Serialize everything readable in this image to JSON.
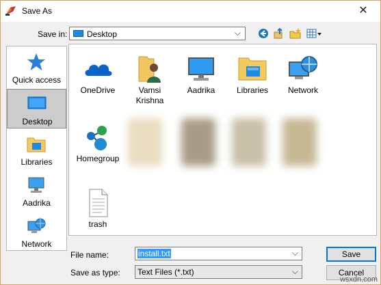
{
  "window": {
    "title": "Save As"
  },
  "save_in": {
    "label": "Save in:",
    "value": "Desktop"
  },
  "places": [
    {
      "label": "Quick access",
      "icon": "quick-access-star-icon"
    },
    {
      "label": "Desktop",
      "icon": "desktop-icon",
      "selected": true
    },
    {
      "label": "Libraries",
      "icon": "libraries-folder-icon"
    },
    {
      "label": "Aadrika",
      "icon": "computer-icon"
    },
    {
      "label": "Network",
      "icon": "network-globe-icon"
    }
  ],
  "items": [
    {
      "label": "OneDrive",
      "icon": "onedrive-cloud-icon"
    },
    {
      "label": "Vamsi Krishna",
      "icon": "user-folder-icon"
    },
    {
      "label": "Aadrika",
      "icon": "computer-icon"
    },
    {
      "label": "Libraries",
      "icon": "libraries-folder-icon"
    },
    {
      "label": "Network",
      "icon": "network-globe-icon"
    },
    {
      "label": "Homegroup",
      "icon": "homegroup-icon"
    },
    {
      "label": "trash",
      "icon": "text-file-icon"
    }
  ],
  "file_name": {
    "label": "File name:",
    "value": "install.txt"
  },
  "save_as_type": {
    "label": "Save as type:",
    "value": "Text Files (*.txt)"
  },
  "buttons": {
    "save": "Save",
    "cancel": "Cancel"
  },
  "watermark": "wsxdn.com",
  "colors": {
    "accent": "#0078d7",
    "selection": "#3399ff",
    "window_border": "#d9a35a"
  }
}
